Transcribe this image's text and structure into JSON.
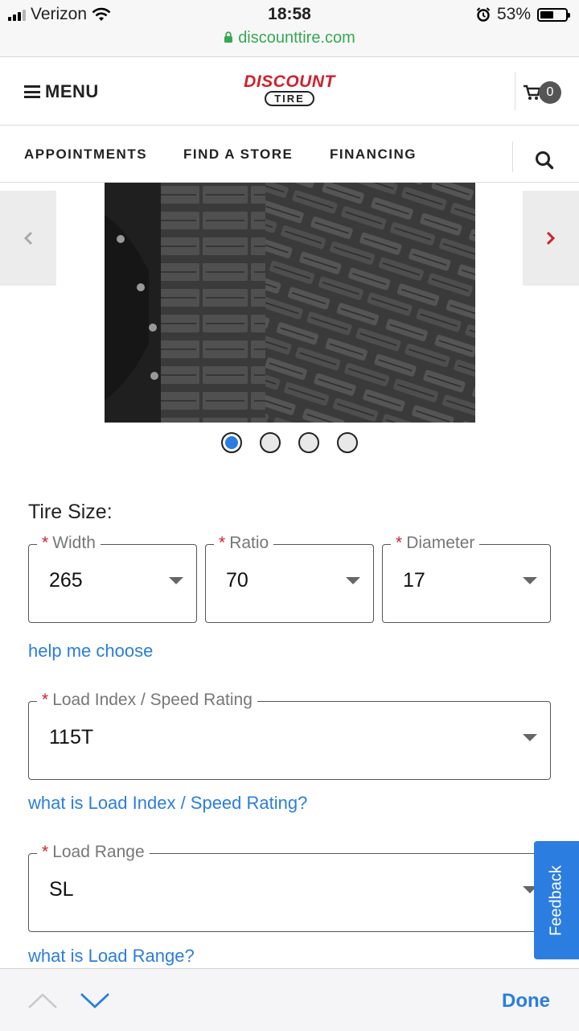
{
  "status": {
    "carrier": "Verizon",
    "time": "18:58",
    "battery": "53%",
    "battery_level": 0.53,
    "url": "discounttire.com"
  },
  "header": {
    "menu_label": "MENU",
    "logo_line1": "DISCOUNT",
    "logo_line2": "TIRE",
    "cart_count": "0"
  },
  "nav": {
    "items": [
      "APPOINTMENTS",
      "FIND A STORE",
      "FINANCING"
    ]
  },
  "carousel": {
    "active_index": 0,
    "dot_count": 4
  },
  "form": {
    "title": "Tire Size:",
    "width": {
      "label": "Width",
      "value": "265"
    },
    "ratio": {
      "label": "Ratio",
      "value": "70"
    },
    "diameter": {
      "label": "Diameter",
      "value": "17"
    },
    "help_link": "help me choose",
    "load_speed": {
      "label": "Load Index / Speed Rating",
      "value": "115T"
    },
    "load_speed_link": "what is Load Index / Speed Rating?",
    "load_range": {
      "label": "Load Range",
      "value": "SL"
    },
    "load_range_link": "what is Load Range?"
  },
  "feedback_label": "Feedback",
  "toolbar": {
    "done_label": "Done"
  },
  "colors": {
    "accent": "#2b7de0",
    "brand_red": "#d21f2b",
    "url_green": "#35a853"
  }
}
